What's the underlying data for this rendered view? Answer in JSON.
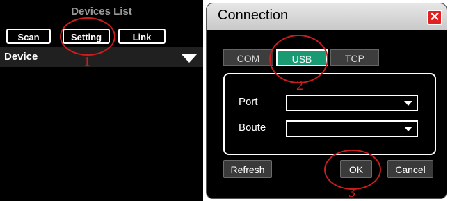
{
  "left_panel": {
    "title": "Devices List",
    "buttons": [
      {
        "label": "Scan"
      },
      {
        "label": "Setting"
      },
      {
        "label": "Link"
      }
    ],
    "device_label": "Device"
  },
  "dialog": {
    "title": "Connection",
    "close_glyph": "✕",
    "tabs": [
      {
        "label": "COM",
        "active": false
      },
      {
        "label": "USB",
        "active": true
      },
      {
        "label": "TCP",
        "active": false
      }
    ],
    "fields": [
      {
        "label": "Port",
        "value": ""
      },
      {
        "label": "Boute",
        "value": ""
      }
    ],
    "buttons": {
      "refresh": "Refresh",
      "ok": "OK",
      "cancel": "Cancel"
    }
  },
  "annotations": [
    "1",
    "2",
    "3"
  ],
  "colors": {
    "active_tab": "#1a9a73",
    "annotation": "#cc1c1c",
    "close_button": "#e12020"
  }
}
